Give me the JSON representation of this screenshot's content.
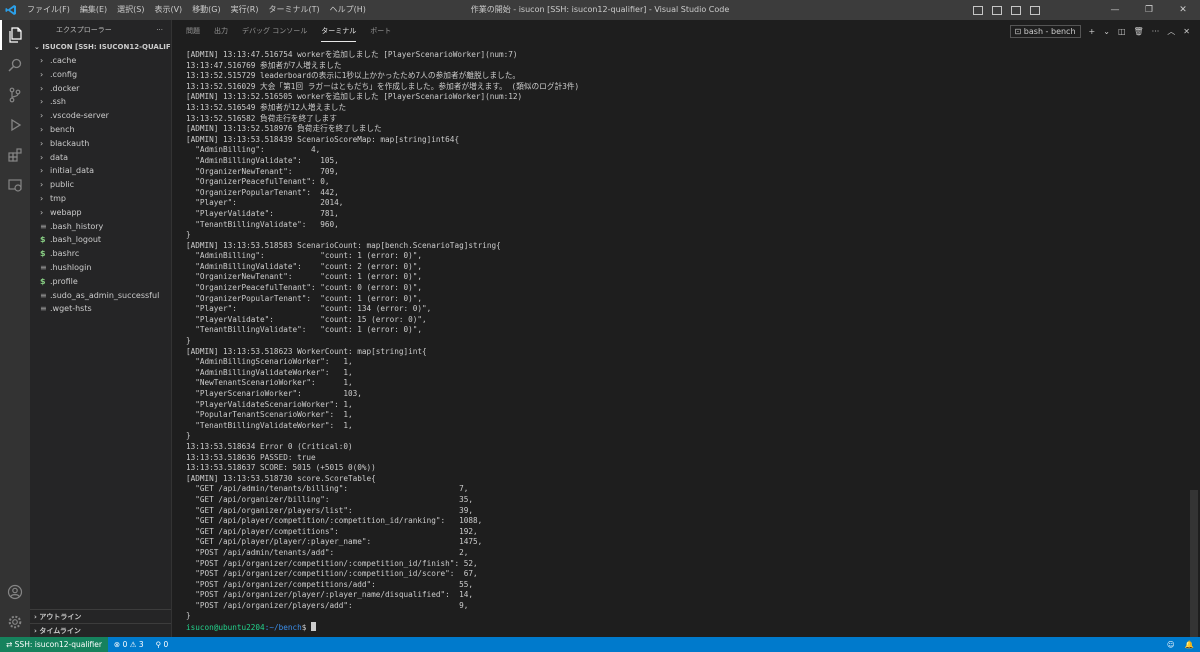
{
  "titlebar": {
    "menu": [
      "ファイル(F)",
      "編集(E)",
      "選択(S)",
      "表示(V)",
      "移動(G)",
      "実行(R)",
      "ターミナル(T)",
      "ヘルプ(H)"
    ],
    "title": "作業の開始 - isucon [SSH: isucon12-qualifier] - Visual Studio Code"
  },
  "sidebar": {
    "header": "エクスプローラー",
    "more": "···",
    "root": "ISUCON [SSH: ISUCON12-QUALIFIER]",
    "items": [
      {
        "label": ".cache",
        "kind": "folder"
      },
      {
        "label": ".config",
        "kind": "folder"
      },
      {
        "label": ".docker",
        "kind": "folder"
      },
      {
        "label": ".ssh",
        "kind": "folder"
      },
      {
        "label": ".vscode-server",
        "kind": "folder"
      },
      {
        "label": "bench",
        "kind": "folder"
      },
      {
        "label": "blackauth",
        "kind": "folder"
      },
      {
        "label": "data",
        "kind": "folder"
      },
      {
        "label": "initial_data",
        "kind": "folder"
      },
      {
        "label": "public",
        "kind": "folder"
      },
      {
        "label": "tmp",
        "kind": "folder"
      },
      {
        "label": "webapp",
        "kind": "folder"
      },
      {
        "label": ".bash_history",
        "kind": "lines"
      },
      {
        "label": ".bash_logout",
        "kind": "shell"
      },
      {
        "label": ".bashrc",
        "kind": "shell"
      },
      {
        "label": ".hushlogin",
        "kind": "lines"
      },
      {
        "label": ".profile",
        "kind": "shell"
      },
      {
        "label": ".sudo_as_admin_successful",
        "kind": "lines"
      },
      {
        "label": ".wget-hsts",
        "kind": "lines"
      }
    ],
    "outline": "アウトライン",
    "timeline": "タイムライン"
  },
  "panel": {
    "tabs": [
      "問題",
      "出力",
      "デバッグ コンソール",
      "ターミナル",
      "ポート"
    ],
    "active_tab": "ターミナル",
    "terminal_selector": "bash - bench",
    "terminal_lines": [
      "[ADMIN] 13:13:47.516754 workerを追加しました [PlayerScenarioWorker](num:7)",
      "13:13:47.516769 参加者が7人増えました",
      "13:13:52.515729 leaderboardの表示に1秒以上かかったため7人の参加者が離脱しました。",
      "13:13:52.516029 大会「第1回 ラガーはともだち」を作成しました。参加者が増えます。 (類似のログ計3件)",
      "[ADMIN] 13:13:52.516505 workerを追加しました [PlayerScenarioWorker](num:12)",
      "13:13:52.516549 参加者が12人増えました",
      "13:13:52.516582 負荷走行を終了します",
      "[ADMIN] 13:13:52.518976 負荷走行を終了しました",
      "[ADMIN] 13:13:53.518439 ScenarioScoreMap: map[string]int64{",
      "  \"AdminBilling\":          4,",
      "  \"AdminBillingValidate\":    105,",
      "  \"OrganizerNewTenant\":      709,",
      "  \"OrganizerPeacefulTenant\": 0,",
      "  \"OrganizerPopularTenant\":  442,",
      "  \"Player\":                  2014,",
      "  \"PlayerValidate\":          781,",
      "  \"TenantBillingValidate\":   960,",
      "}",
      "[ADMIN] 13:13:53.518583 ScenarioCount: map[bench.ScenarioTag]string{",
      "  \"AdminBilling\":            \"count: 1 (error: 0)\",",
      "  \"AdminBillingValidate\":    \"count: 2 (error: 0)\",",
      "  \"OrganizerNewTenant\":      \"count: 1 (error: 0)\",",
      "  \"OrganizerPeacefulTenant\": \"count: 0 (error: 0)\",",
      "  \"OrganizerPopularTenant\":  \"count: 1 (error: 0)\",",
      "  \"Player\":                  \"count: 134 (error: 0)\",",
      "  \"PlayerValidate\":          \"count: 15 (error: 0)\",",
      "  \"TenantBillingValidate\":   \"count: 1 (error: 0)\",",
      "}",
      "[ADMIN] 13:13:53.518623 WorkerCount: map[string]int{",
      "  \"AdminBillingScenarioWorker\":   1,",
      "  \"AdminBillingValidateWorker\":   1,",
      "  \"NewTenantScenarioWorker\":      1,",
      "  \"PlayerScenarioWorker\":         103,",
      "  \"PlayerValidateScenarioWorker\": 1,",
      "  \"PopularTenantScenarioWorker\":  1,",
      "  \"TenantBillingValidateWorker\":  1,",
      "}",
      "13:13:53.518634 Error 0 (Critical:0)",
      "13:13:53.518636 PASSED: true",
      "13:13:53.518637 SCORE: 5015 (+5015 0(0%))",
      "[ADMIN] 13:13:53.518730 score.ScoreTable{",
      "  \"GET /api/admin/tenants/billing\":                        7,",
      "  \"GET /api/organizer/billing\":                            35,",
      "  \"GET /api/organizer/players/list\":                       39,",
      "  \"GET /api/player/competition/:competition_id/ranking\":   1088,",
      "  \"GET /api/player/competitions\":                          192,",
      "  \"GET /api/player/player/:player_name\":                   1475,",
      "  \"POST /api/admin/tenants/add\":                           2,",
      "  \"POST /api/organizer/competition/:competition_id/finish\": 52,",
      "  \"POST /api/organizer/competition/:competition_id/score\":  67,",
      "  \"POST /api/organizer/competitions/add\":                  55,",
      "  \"POST /api/organizer/player/:player_name/disqualified\":  14,",
      "  \"POST /api/organizer/players/add\":                       9,",
      "}"
    ],
    "prompt_user": "isucon@ubuntu2204",
    "prompt_path": ":~/bench",
    "prompt_symbol": "$ "
  },
  "statusbar": {
    "remote": "SSH: isucon12-qualifier",
    "problems": "⊗ 0 ⚠ 3",
    "ports": "⚲ 0"
  }
}
